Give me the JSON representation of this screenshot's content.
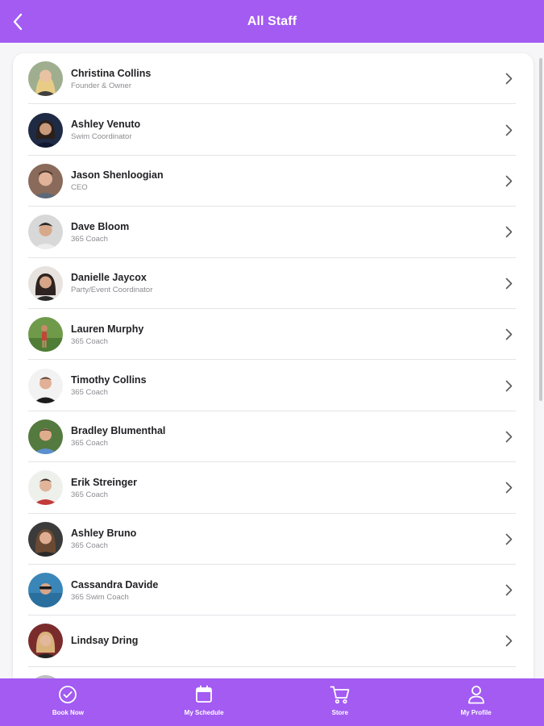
{
  "header": {
    "title": "All Staff"
  },
  "staff": [
    {
      "name": "Christina Collins",
      "role": "Founder & Owner"
    },
    {
      "name": "Ashley Venuto",
      "role": "Swim Coordinator"
    },
    {
      "name": "Jason Shenloogian",
      "role": "CEO"
    },
    {
      "name": "Dave Bloom",
      "role": "365 Coach"
    },
    {
      "name": "Danielle Jaycox",
      "role": "Party/Event Coordinator"
    },
    {
      "name": "Lauren Murphy",
      "role": "365 Coach"
    },
    {
      "name": "Timothy Collins",
      "role": "365 Coach"
    },
    {
      "name": "Bradley Blumenthal",
      "role": "365 Coach"
    },
    {
      "name": "Erik Streinger",
      "role": "365 Coach"
    },
    {
      "name": "Ashley Bruno",
      "role": "365 Coach"
    },
    {
      "name": "Cassandra Davide",
      "role": "365 Swim Coach"
    },
    {
      "name": "Lindsay Dring",
      "role": ""
    }
  ],
  "nav": {
    "items": [
      {
        "label": "Book Now",
        "icon": "check-circle-icon"
      },
      {
        "label": "My Schedule",
        "icon": "calendar-icon"
      },
      {
        "label": "Store",
        "icon": "cart-icon"
      },
      {
        "label": "My Profile",
        "icon": "user-icon"
      }
    ]
  },
  "colors": {
    "brand": "#a35bf2",
    "card": "#ffffff",
    "divider": "#e4e4e8"
  }
}
